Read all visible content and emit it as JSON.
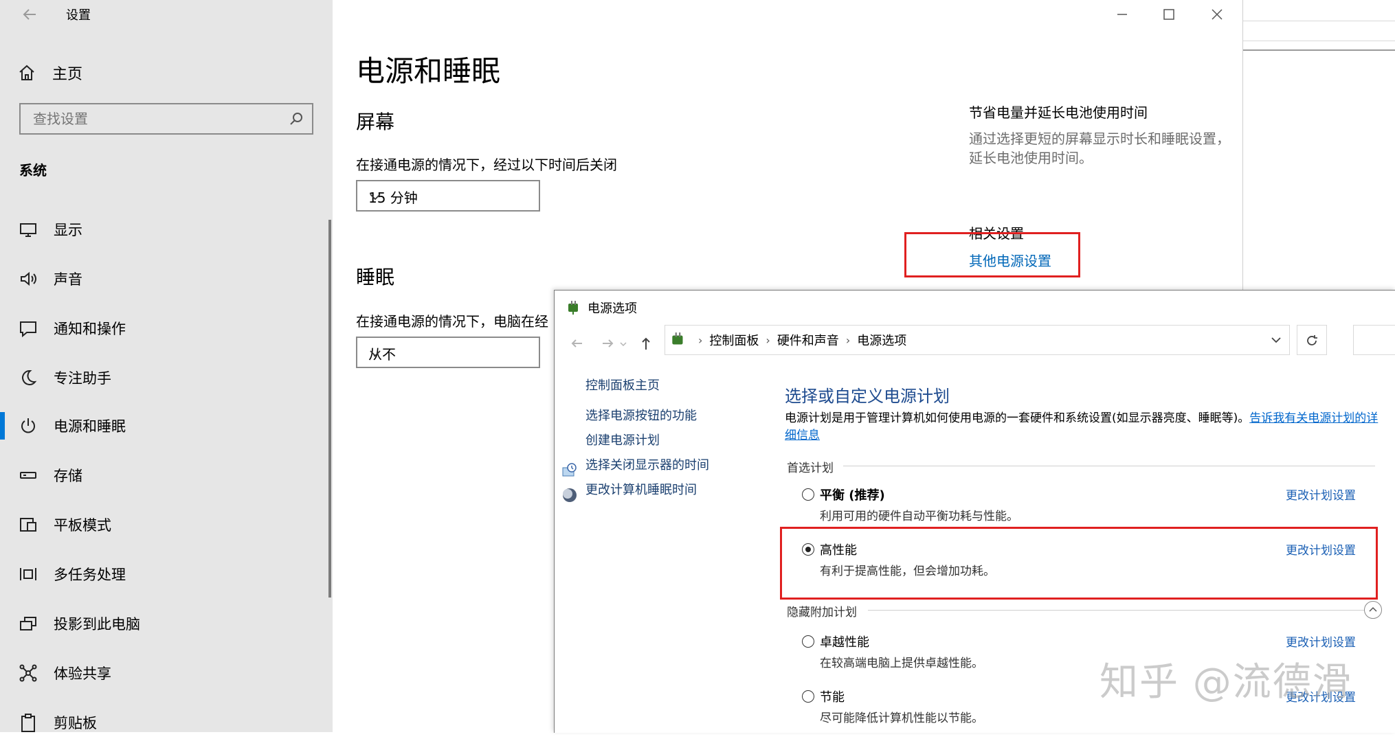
{
  "settings": {
    "title": "设置",
    "home": "主页",
    "search_placeholder": "查找设置",
    "section": "系统",
    "nav": [
      {
        "label": "显示",
        "icon": "monitor-icon"
      },
      {
        "label": "声音",
        "icon": "speaker-icon"
      },
      {
        "label": "通知和操作",
        "icon": "notification-icon"
      },
      {
        "label": "专注助手",
        "icon": "moon-icon"
      },
      {
        "label": "电源和睡眠",
        "icon": "power-icon",
        "active": true
      },
      {
        "label": "存储",
        "icon": "storage-icon"
      },
      {
        "label": "平板模式",
        "icon": "tablet-icon"
      },
      {
        "label": "多任务处理",
        "icon": "multitask-icon"
      },
      {
        "label": "投影到此电脑",
        "icon": "project-icon"
      },
      {
        "label": "体验共享",
        "icon": "share-icon"
      },
      {
        "label": "剪贴板",
        "icon": "clipboard-icon"
      }
    ],
    "page_title": "电源和睡眠",
    "screen_heading": "屏幕",
    "screen_label": "在接通电源的情况下，经过以下时间后关闭",
    "screen_value": "15 分钟",
    "sleep_heading": "睡眠",
    "sleep_label": "在接通电源的情况下，电脑在经",
    "sleep_value": "从不",
    "tip_title": "节省电量并延长电池使用时间",
    "tip_desc": "通过选择更短的屏幕显示时长和睡眠设置，延长电池使用时间。",
    "related_title": "相关设置",
    "related_link": "其他电源设置"
  },
  "power_options": {
    "title": "电源选项",
    "breadcrumb": [
      "控制面板",
      "硬件和声音",
      "电源选项"
    ],
    "left_links": [
      {
        "label": "控制面板主页",
        "icon": ""
      },
      {
        "label": "选择电源按钮的功能",
        "icon": ""
      },
      {
        "label": "创建电源计划",
        "icon": ""
      },
      {
        "label": "选择关闭显示器的时间",
        "icon": "display-clock-icon"
      },
      {
        "label": "更改计算机睡眠时间",
        "icon": "sleep-moon-icon"
      }
    ],
    "heading": "选择或自定义电源计划",
    "desc": "电源计划是用于管理计算机如何使用电源的一套硬件和系统设置(如显示器亮度、睡眠等)。",
    "desc_link": "告诉我有关电源计划的详细信息",
    "preferred_label": "首选计划",
    "hidden_label": "隐藏附加计划",
    "plans": [
      {
        "name": "平衡 (推荐)",
        "desc": "利用可用的硬件自动平衡功耗与性能。",
        "link": "更改计划设置",
        "selected": false
      },
      {
        "name": "高性能",
        "desc": "有利于提高性能，但会增加功耗。",
        "link": "更改计划设置",
        "selected": true
      },
      {
        "name": "卓越性能",
        "desc": "在较高端电脑上提供卓越性能。",
        "link": "更改计划设置",
        "selected": false
      },
      {
        "name": "节能",
        "desc": "尽可能降低计算机性能以节能。",
        "link": "更改计划设置",
        "selected": false
      }
    ]
  },
  "watermark": "知乎 @流德滑",
  "colors": {
    "accent": "#0078d7",
    "highlight": "#e02020",
    "link": "#0067b8"
  }
}
